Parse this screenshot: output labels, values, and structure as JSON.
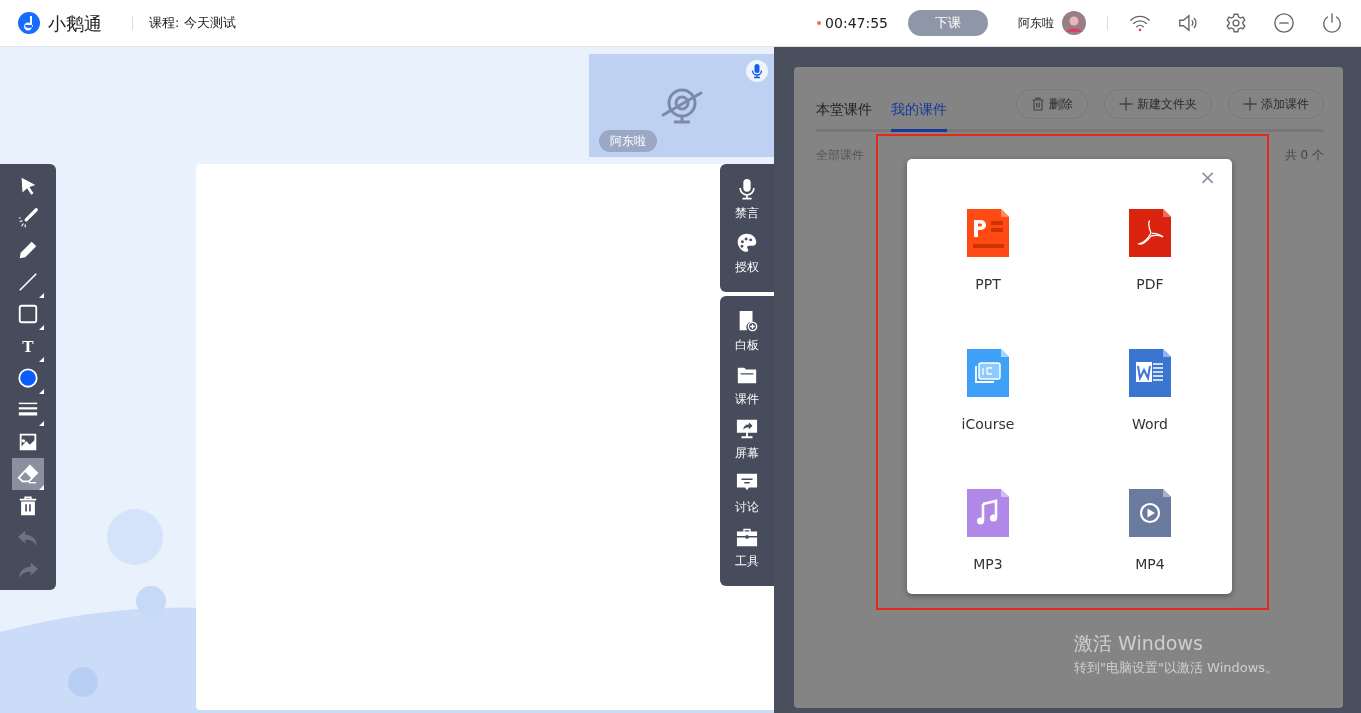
{
  "app": {
    "name": "小鹅通",
    "course": "课程: 今天测试"
  },
  "header": {
    "timer": "00:47:55",
    "end_button": "下课",
    "user_name": "阿东啦"
  },
  "video_tile": {
    "name": "阿东啦",
    "camera_off": true
  },
  "tools": [
    {
      "kind": "select",
      "selected": false,
      "has_menu": false,
      "disabled": false
    },
    {
      "kind": "laser",
      "selected": false,
      "has_menu": false,
      "disabled": false
    },
    {
      "kind": "pen",
      "selected": false,
      "has_menu": false,
      "disabled": false
    },
    {
      "kind": "line",
      "selected": false,
      "has_menu": true,
      "disabled": false
    },
    {
      "kind": "rect",
      "selected": false,
      "has_menu": true,
      "disabled": false
    },
    {
      "kind": "text",
      "glyph": "T",
      "selected": false,
      "has_menu": true,
      "disabled": false
    },
    {
      "kind": "color",
      "color": "#0a5cff",
      "selected": false,
      "has_menu": true,
      "disabled": false
    },
    {
      "kind": "thickness",
      "selected": false,
      "has_menu": true,
      "disabled": false
    },
    {
      "kind": "image",
      "selected": false,
      "has_menu": false,
      "disabled": false
    },
    {
      "kind": "eraser",
      "selected": true,
      "has_menu": true,
      "disabled": false
    },
    {
      "kind": "delete",
      "selected": false,
      "has_menu": false,
      "disabled": false
    },
    {
      "kind": "undo",
      "selected": false,
      "has_menu": false,
      "disabled": true
    },
    {
      "kind": "redo",
      "selected": false,
      "has_menu": false,
      "disabled": true
    }
  ],
  "side_toolbars": [
    {
      "items": [
        {
          "kind": "mute",
          "label": "禁言"
        },
        {
          "kind": "authorize",
          "label": "授权"
        }
      ]
    },
    {
      "items": [
        {
          "kind": "whiteboard",
          "label": "白板"
        },
        {
          "kind": "courseware",
          "label": "课件"
        },
        {
          "kind": "screen",
          "label": "屏幕"
        },
        {
          "kind": "discussion",
          "label": "讨论"
        },
        {
          "kind": "toolbox",
          "label": "工具"
        }
      ]
    }
  ],
  "courseware_panel": {
    "tabs": [
      {
        "label": "本堂课件",
        "selected": false
      },
      {
        "label": "我的课件",
        "selected": true
      }
    ],
    "actions": [
      {
        "kind": "delete",
        "label": "删除"
      },
      {
        "kind": "add",
        "label": "新建文件夹"
      },
      {
        "kind": "add",
        "label": "添加课件"
      }
    ],
    "breadcrumb": "全部课件",
    "count": "共 0 个"
  },
  "add_dialog": {
    "close": "×",
    "file_types": [
      {
        "kind": "ppt",
        "label": "PPT"
      },
      {
        "kind": "pdf",
        "label": "PDF"
      },
      {
        "kind": "icourse",
        "label": "iCourse"
      },
      {
        "kind": "word",
        "label": "Word"
      },
      {
        "kind": "mp3",
        "label": "MP3"
      },
      {
        "kind": "mp4",
        "label": "MP4"
      }
    ]
  },
  "windows_activation": {
    "title": "激活 Windows",
    "hint": "转到\"电脑设置\"以激活 Windows。"
  }
}
